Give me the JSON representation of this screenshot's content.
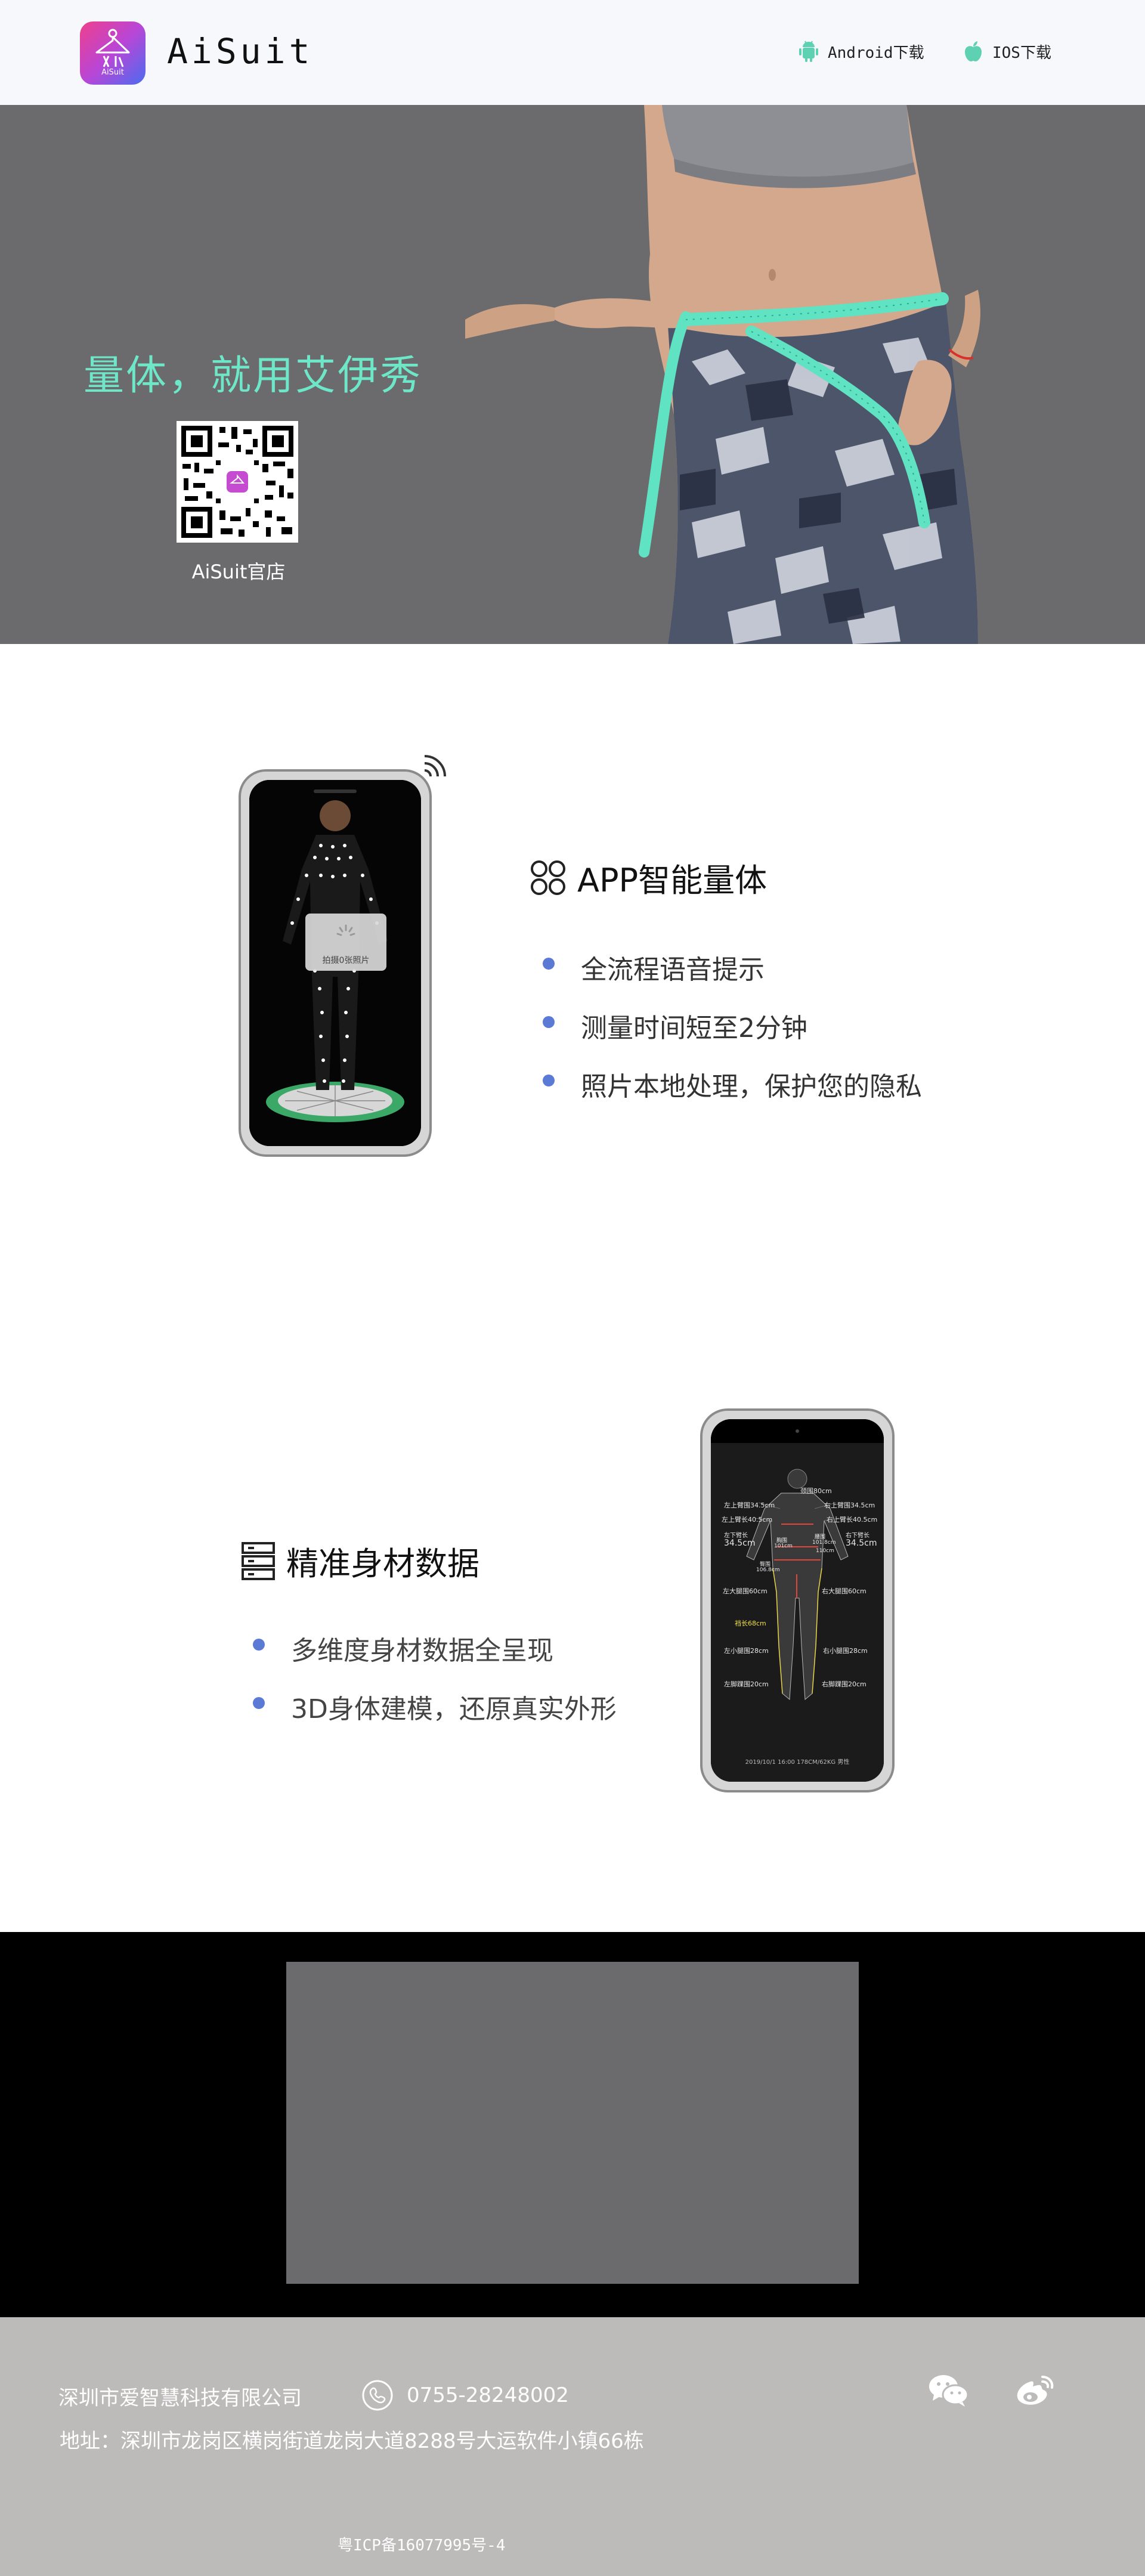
{
  "header": {
    "logo_sub": "AiSuit",
    "brand": "AiSuit",
    "android_label": "Android下载",
    "ios_label": "IOS下载"
  },
  "hero": {
    "slogan": "量体，就用艾伊秀",
    "qr_caption": "AiSuit官店"
  },
  "feature1": {
    "title": "APP智能量体",
    "bullets": [
      "全流程语音提示",
      "测量时间短至2分钟",
      "照片本地处理，保护您的隐私"
    ],
    "screen_overlay": "拍摄0张照片"
  },
  "feature2": {
    "title": "精准身材数据",
    "bullets": [
      "多维度身材数据全呈现",
      "3D身体建模，还原真实外形"
    ],
    "screen_labels": {
      "neck": "颈围80cm",
      "l_upper1": "左上臂围34.5cm",
      "r_upper1": "右上臂围34.5cm",
      "l_upper2": "左上臂长40.5cm",
      "r_upper2": "右上臂长40.5cm",
      "l_arm": "左下臂长",
      "l_arm_val": "34.5cm",
      "r_arm": "右下臂长",
      "r_arm_val": "34.5cm",
      "chest": "胸围",
      "chest_val": "101cm",
      "waist": "腰围",
      "waist_val": "101.8cm",
      "hip_l": "臀围",
      "hip_val": "106.8cm",
      "hip_r": "110cm",
      "l_thigh": "左大腿围60cm",
      "r_thigh": "右大腿围60cm",
      "inseam": "裆长68cm",
      "l_calf": "左小腿围28cm",
      "r_calf": "右小腿围28cm",
      "l_ankle": "左脚踝围20cm",
      "r_ankle": "右脚踝围20cm",
      "bottom_bar": "2019/10/1  16:00  178CM/62KG  男性"
    }
  },
  "footer": {
    "company": "深圳市爱智慧科技有限公司",
    "phone": "0755-28248002",
    "address": "地址：深圳市龙岗区横岗街道龙岗大道8288号大运软件小镇66栋",
    "icp": "粤ICP备16077995号-4"
  },
  "colors": {
    "accent_teal": "#6ee6c8",
    "bullet_blue": "#5b7ad6",
    "hero_bg": "#6b6a6c",
    "footer_bg": "#bdbaba"
  },
  "icons": [
    "android-icon",
    "apple-icon",
    "feature-grid-icon",
    "data-list-icon",
    "phone-icon",
    "wechat-icon",
    "weibo-icon",
    "wifi-signal-icon"
  ]
}
